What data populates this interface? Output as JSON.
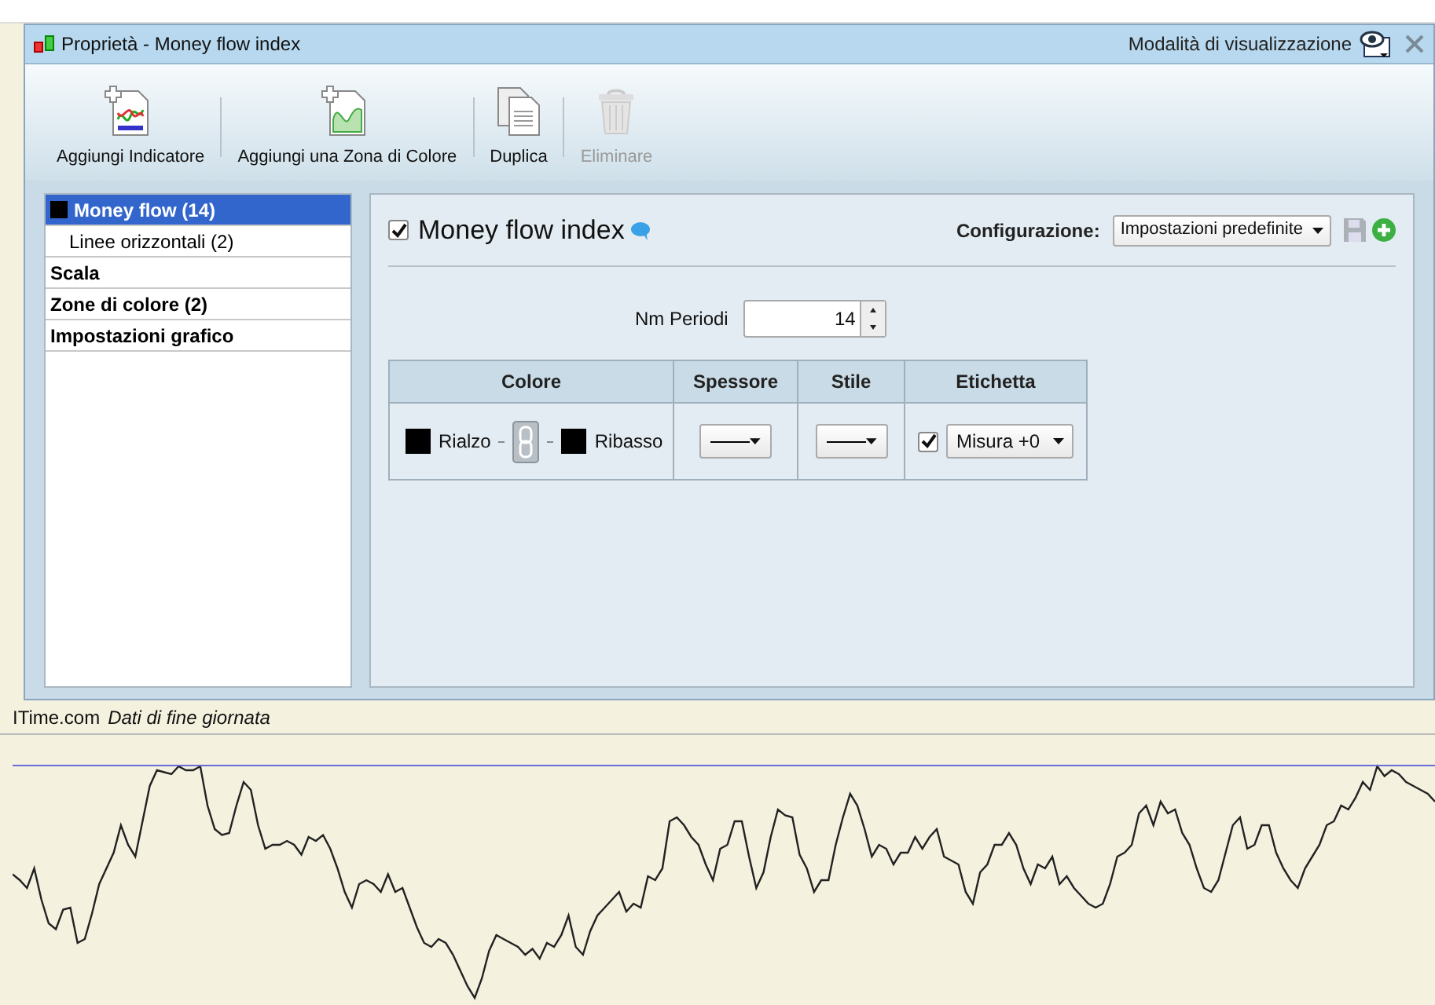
{
  "window": {
    "title": "Proprietà - Money flow index",
    "view_mode_label": "Modalità di visualizzazione"
  },
  "toolbar": [
    {
      "kind": "indicator",
      "label": "Aggiungi Indicatore",
      "disabled": false
    },
    {
      "kind": "zone",
      "label": "Aggiungi una Zona di Colore",
      "disabled": false
    },
    {
      "kind": "duplicate",
      "label": "Duplica",
      "disabled": false
    },
    {
      "kind": "delete",
      "label": "Eliminare",
      "disabled": true
    }
  ],
  "sidebar": {
    "items": [
      {
        "label": "Money flow (14)",
        "selected": true,
        "children": [
          {
            "label": "Linee orizzontali (2)",
            "selected": false
          }
        ]
      },
      {
        "label": "Scala",
        "selected": false
      },
      {
        "label": "Zone di colore (2)",
        "selected": false
      },
      {
        "label": "Impostazioni grafico",
        "selected": false
      }
    ]
  },
  "panel": {
    "title": "Money flow index",
    "enabled": true,
    "configuration": {
      "label": "Configurazione:",
      "value": "Impostazioni predefinite"
    },
    "periods": {
      "label": "Nm Periodi",
      "value": "14"
    },
    "table": {
      "columns": [
        "Colore",
        "Spessore",
        "Stile",
        "Etichetta"
      ],
      "row": {
        "up_label": "Rialzo",
        "down_label": "Ribasso",
        "label_checked": true,
        "label_value": "Misura +0"
      }
    }
  },
  "footer": {
    "source": "ITime.com",
    "note": "Dati di fine giornata"
  }
}
